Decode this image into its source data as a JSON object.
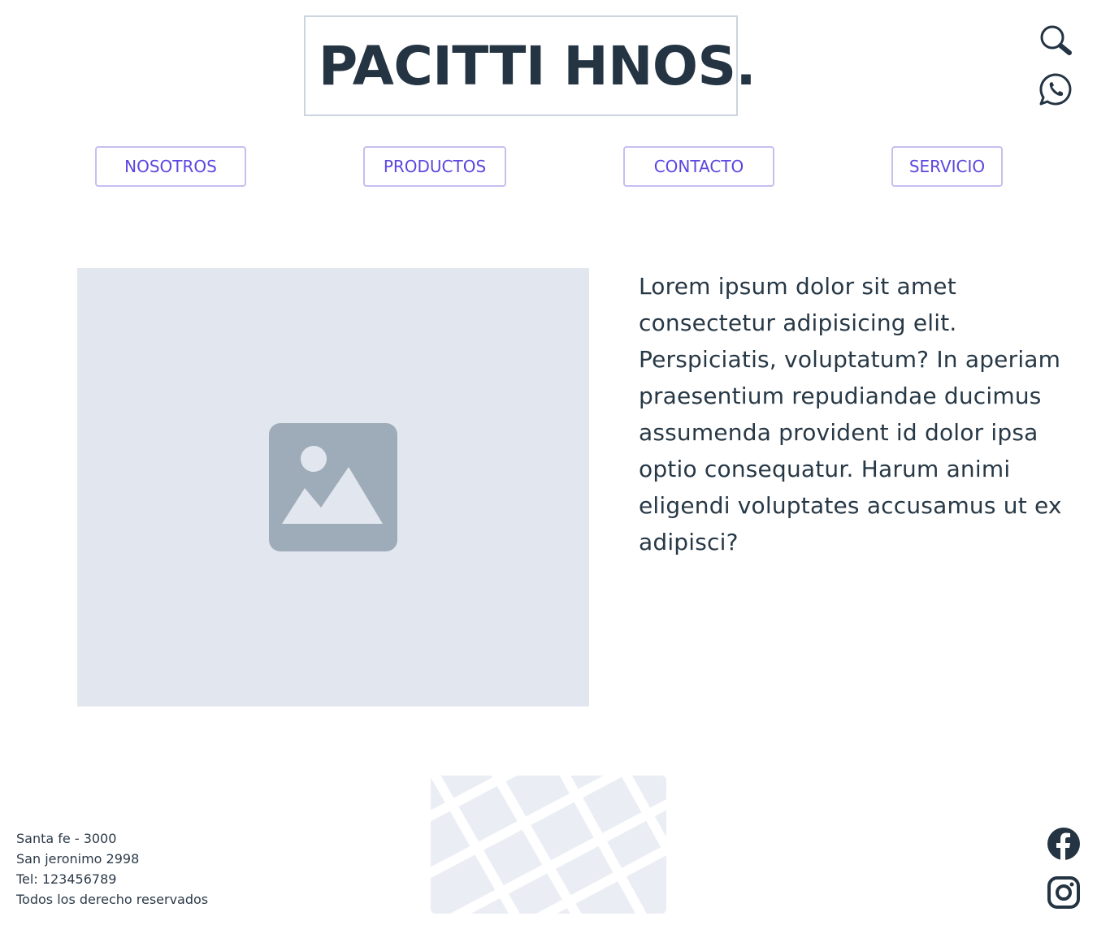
{
  "header": {
    "logo_text": "PACITTI HNOS.",
    "icons": [
      "search-icon",
      "whatsapp-icon"
    ]
  },
  "nav": {
    "items": [
      {
        "label": "NOSOTROS"
      },
      {
        "label": "PRODUCTOS"
      },
      {
        "label": "CONTACTO"
      },
      {
        "label": "SERVICIO"
      }
    ]
  },
  "main": {
    "image_icon": "image-placeholder-icon",
    "paragraph": "Lorem ipsum dolor sit amet consectetur adipisicing elit. Perspiciatis, voluptatum? In aperiam praesentium repudiandae ducimus assumenda provident id dolor ipsa optio consequatur. Harum animi eligendi voluptates accusamus ut ex adipisci?"
  },
  "footer": {
    "lines": [
      "Santa fe - 3000",
      "San jeronimo 2998",
      "Tel: 123456789",
      "Todos los derecho reservados"
    ],
    "map_icon": "map-placeholder",
    "social": [
      "facebook-icon",
      "instagram-icon"
    ]
  },
  "colors": {
    "logo": "#243443",
    "nav_text": "#5b46e0",
    "nav_border": "#c6bff0",
    "placeholder_bg": "#e2e7ef",
    "placeholder_icon": "#9eacb9",
    "text": "#273846"
  }
}
